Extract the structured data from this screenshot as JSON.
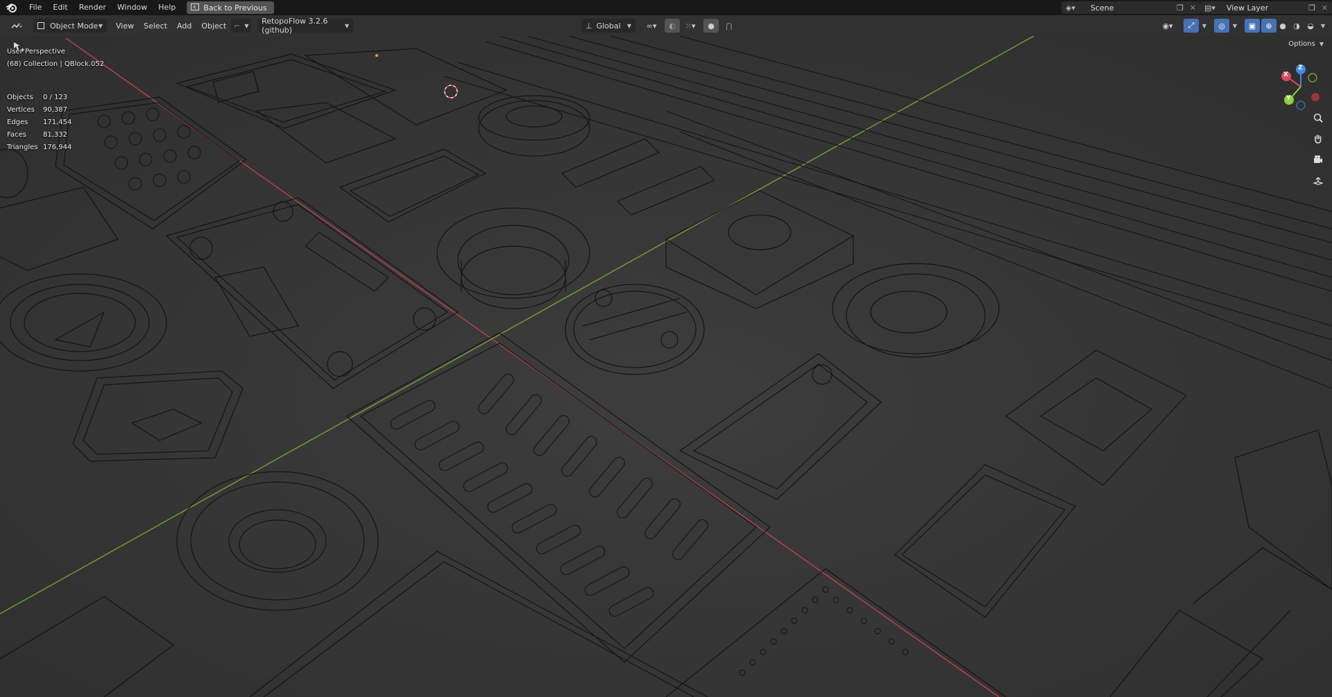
{
  "topbar": {
    "menus": [
      "File",
      "Edit",
      "Render",
      "Window",
      "Help"
    ],
    "back_button": "Back to Previous",
    "scene_label": "Scene",
    "view_layer_label": "View Layer"
  },
  "header": {
    "mode": "Object Mode",
    "menus": [
      "View",
      "Select",
      "Add",
      "Object"
    ],
    "addon": "RetopoFlow 3.2.6 (github)",
    "transform_orientation": "Global",
    "options_label": "Options"
  },
  "overlay": {
    "perspective": "User Perspective",
    "collection": "(68) Collection | QBlock.052"
  },
  "stats": [
    {
      "label": "Objects",
      "value": "0 / 123"
    },
    {
      "label": "Vertices",
      "value": "90,387"
    },
    {
      "label": "Edges",
      "value": "171,454"
    },
    {
      "label": "Faces",
      "value": "81,332"
    },
    {
      "label": "Triangles",
      "value": "176,944"
    }
  ],
  "gizmo": {
    "x": "X",
    "y": "Y",
    "z": "Z"
  },
  "icons": [
    "blender-logo-icon",
    "back-icon",
    "editor-type-icon",
    "object-mode-icon",
    "transform-orientation-icon",
    "pivot-icon",
    "snap-icon",
    "proportional-icon",
    "visibility-icon",
    "gizmo-toggle-icon",
    "overlay-icon",
    "xray-icon",
    "wireframe-shading-icon",
    "solid-shading-icon",
    "material-shading-icon",
    "rendered-shading-icon",
    "zoom-icon",
    "pan-hand-icon",
    "camera-icon",
    "ortho-grid-icon",
    "select-box-tool-icon"
  ],
  "colors": {
    "x_axis": "#e0475b",
    "y_axis": "#8bd03e",
    "z_axis": "#3f8ee6",
    "accent": "#4772b3",
    "viewport_bg": "#393939",
    "wire": "#0d0d0d"
  }
}
